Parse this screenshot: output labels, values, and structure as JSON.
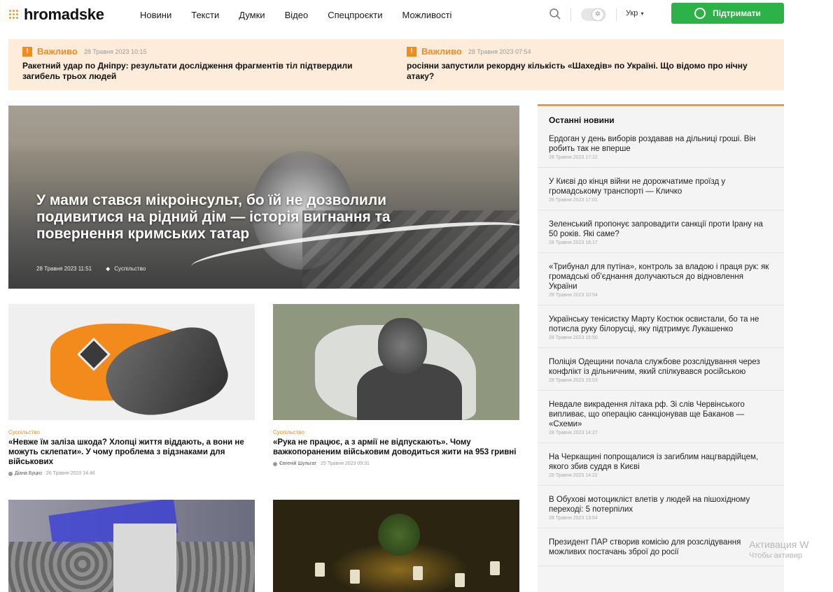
{
  "header": {
    "logo_text": "hromadske",
    "nav": [
      "Новини",
      "Тексти",
      "Думки",
      "Відео",
      "Спецпроєкти",
      "Можливості"
    ],
    "lang": "Укр",
    "support_label": "Підтримати",
    "brand_color": "#f39a2c",
    "support_color": "#2db24a"
  },
  "important": {
    "items": [
      {
        "badge": "!",
        "label": "Важливо",
        "date": "28 Травня 2023 10:15",
        "title": "Ракетний удар по Дніпру: результати дослідження фрагментів тіл підтвердили загибель трьох людей"
      },
      {
        "badge": "!",
        "label": "Важливо",
        "date": "28 Травня 2023 07:54",
        "title": "росіяни запустили рекордну кількість «Шахедів» по Україні. Що відомо про нічну атаку?"
      }
    ]
  },
  "hero": {
    "title": "У мами стався мікроінсульт, бо їй не дозволили подивитися на рідний дім — історія вигнання та повернення кримських татар",
    "date": "28 Травня 2023 11:51",
    "category": "Суспільство"
  },
  "cards": [
    {
      "category": "Суспільство",
      "title": "«Невже їм заліза шкода? Хлопці життя віддають, а вони не можуть склепати». У чому проблема з відзнаками для військових",
      "author": "Діана Буцко",
      "date": "26 Травня 2023 14:46"
    },
    {
      "category": "Суспільство",
      "title": "«Рука не працює, а з армії не відпускають». Чому важкопораненим військовим доводиться жити на 953 гривні",
      "author": "Євгеній Шульгат",
      "date": "25 Травня 2023 09:31"
    }
  ],
  "sidebar": {
    "title": "Останні новини",
    "items": [
      {
        "title": "Ердоган у день виборів роздавав на дільниці гроші. Він робить так не вперше",
        "date": "28 Травня 2023 17:22"
      },
      {
        "title": "У Києві до кінця війни не дорожчатиме проїзд у громадському транспорті — Кличко",
        "date": "28 Травня 2023 17:01"
      },
      {
        "title": "Зеленський пропонує запровадити санкції проти Ірану на 50 років. Які саме?",
        "date": "28 Травня 2023 16:17"
      },
      {
        "title": "«Трибунал для путіна», контроль за владою і праця рук: як громадські об'єднання долучаються до відновлення України",
        "date": "28 Травня 2023 10:54"
      },
      {
        "title": "Українську тенісистку Марту Костюк освистали, бо та не потисла руку білорусці, яку підтримує Лукашенко",
        "date": "28 Травня 2023 15:50"
      },
      {
        "title": "Поліція Одещини почала службове розслідування через конфлікт із дільничним, який спілкувався російською",
        "date": "28 Травня 2023 15:03"
      },
      {
        "title": "Невдале викрадення літака рф. Зі слів Червінського випливає, що операцію санкціонував ще Баканов — «Схеми»",
        "date": "28 Травня 2023 14:27"
      },
      {
        "title": "На Черкащині попрощалися із загиблим нацгвардійцем, якого збив суддя в Києві",
        "date": "28 Травня 2023 14:22"
      },
      {
        "title": "В Обухові мотоцикліст влетів у людей на пішохідному переході: 5 потерпілих",
        "date": "28 Травня 2023 13:54"
      },
      {
        "title": "Президент ПАР створив комісію для розслідування можливих постачань зброї до росії",
        "date": ""
      }
    ]
  },
  "activation": {
    "line1": "Активация W",
    "line2": "Чтобы активир"
  }
}
